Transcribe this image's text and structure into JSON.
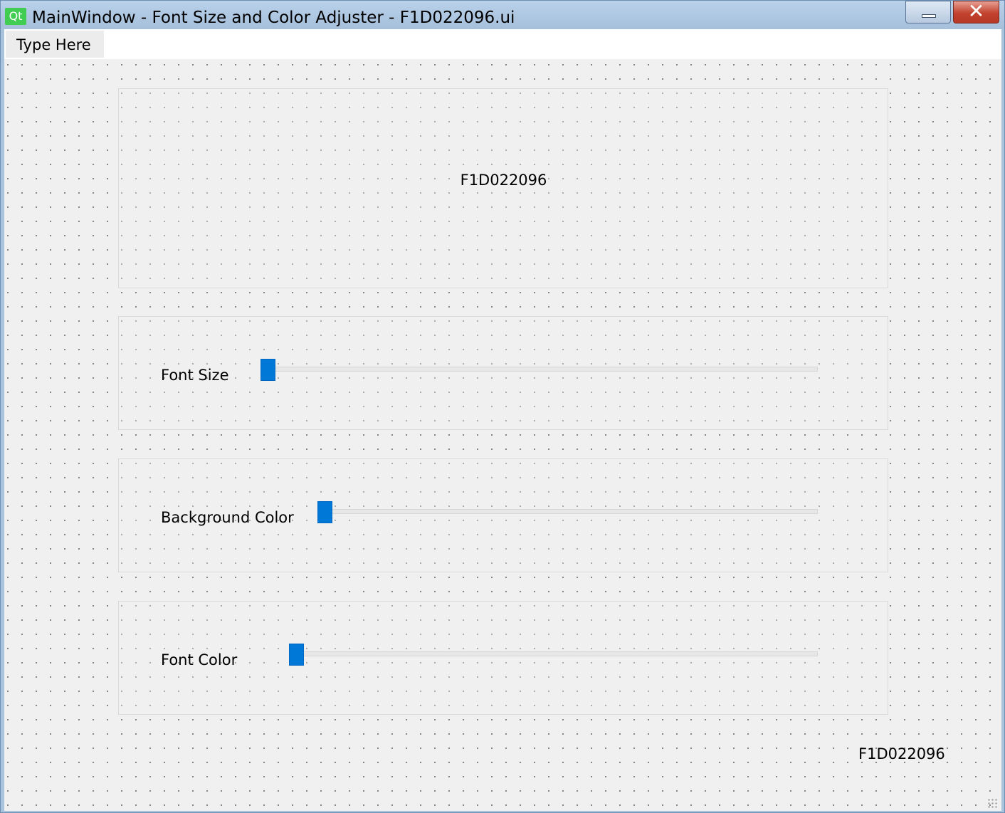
{
  "window": {
    "title": "MainWindow - Font Size and Color Adjuster - F1D022096.ui",
    "app_icon_text": "Qt",
    "close_glyph": "✕"
  },
  "menubar": {
    "items": [
      {
        "label": "Type Here"
      }
    ]
  },
  "display": {
    "text": "F1D022096"
  },
  "controls": {
    "font_size": {
      "label": "Font Size",
      "value": 0
    },
    "background_color": {
      "label": "Background Color",
      "value": 0
    },
    "font_color": {
      "label": "Font Color",
      "value": 0
    }
  },
  "footer": {
    "text": "F1D022096"
  },
  "colors": {
    "slider_handle": "#0078d7",
    "title_bar": "#a9c3dc",
    "close_button": "#c2422e",
    "qt_icon": "#41cd52"
  }
}
